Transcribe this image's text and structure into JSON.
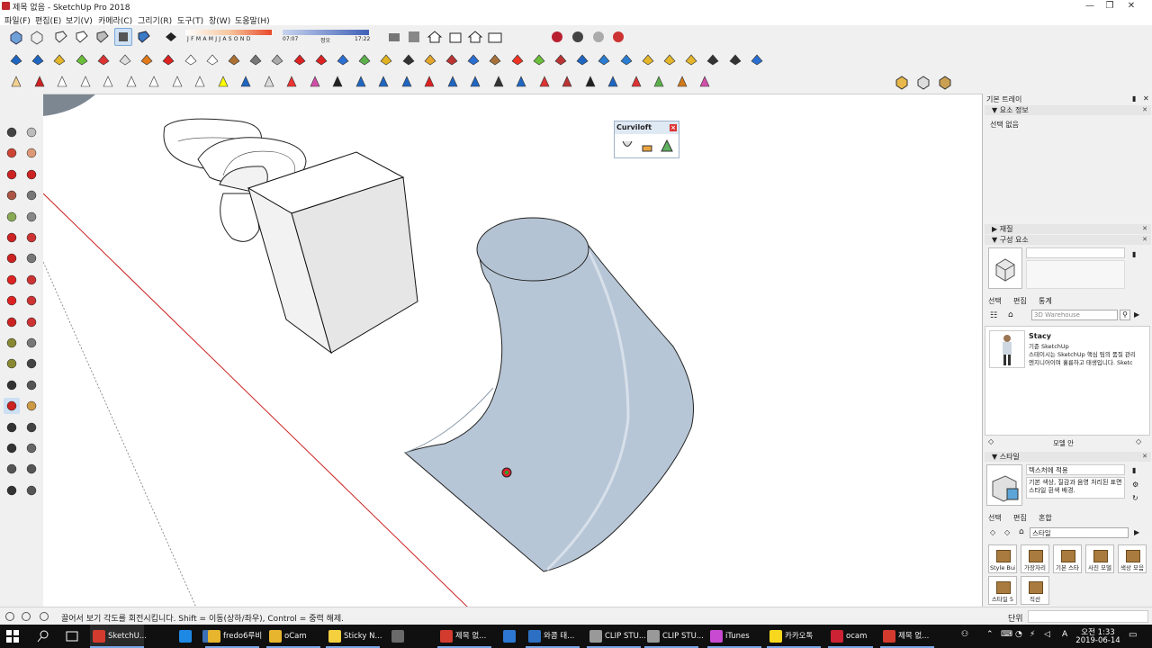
{
  "window": {
    "title": "제목 없음 - SketchUp Pro 2018",
    "minimize": "—",
    "maximize": "❐",
    "close": "✕"
  },
  "menu": [
    "파일(F)",
    "편집(E)",
    "보기(V)",
    "카메라(C)",
    "그리기(R)",
    "도구(T)",
    "창(W)",
    "도움말(H)"
  ],
  "shadow": {
    "months": "J F M A M J J A S O N D",
    "time_start": "07:07",
    "noon": "정오",
    "time_end": "17:22"
  },
  "curviloft": {
    "title": "Curviloft"
  },
  "tray": {
    "title": "기본 트레이",
    "entity_info": {
      "header": "요소 정보",
      "text": "선택 없음"
    },
    "materials": {
      "header": "재질"
    },
    "components": {
      "header": "구성 요소",
      "tabs": [
        "선택",
        "편집",
        "통계"
      ],
      "search_placeholder": "3D Warehouse",
      "item_name": "Stacy",
      "item_line1": "기준 SketchUp",
      "item_line2": "스테이시는 SketchUp 핵심 팀의 품질 관리",
      "item_line3": "엔지니어이며 훌륭하고 태생입니다. Sketc",
      "footer": "모델 안"
    },
    "styles": {
      "header": "스타일",
      "name": "텍스처에 적용",
      "desc": "기본 색상, 질감과 음영 처리된 표면 스타일 흰색 배경.",
      "tabs": [
        "선택",
        "편집",
        "혼합"
      ],
      "dropdown": "스타일",
      "swatches": [
        "Style Buil",
        "가장자리",
        "기본 스타",
        "사진 모델",
        "색상 모음",
        "스타일 5",
        "직선"
      ]
    },
    "unit_label": "단위"
  },
  "status": {
    "message": "끌어서 보기 각도를 회전시킵니다. Shift = 이동(상하/좌우), Control = 중력 해제."
  },
  "taskbar": {
    "items": [
      {
        "label": "SketchU...",
        "color": "#d33b2f"
      },
      {
        "label": "",
        "color": "#1e88e5"
      },
      {
        "label": "",
        "color": "#3d6fb5"
      },
      {
        "label": "fredo6루비",
        "color": "#e7b52e"
      },
      {
        "label": "oCam",
        "color": "#e7b52e"
      },
      {
        "label": "Sticky N...",
        "color": "#f4d03f"
      },
      {
        "label": "",
        "color": "#6a6a6a"
      },
      {
        "label": "제목 없...",
        "color": "#d33b2f"
      },
      {
        "label": "",
        "color": "#2c78d2"
      },
      {
        "label": "와콤 태...",
        "color": "#2d6fc3"
      },
      {
        "label": "CLIP STU...",
        "color": "#999999"
      },
      {
        "label": "CLIP STU...",
        "color": "#999999"
      },
      {
        "label": "iTunes",
        "color": "#c84ad0"
      },
      {
        "label": "카카오톡",
        "color": "#f7d81e"
      },
      {
        "label": "ocam",
        "color": "#cc2233"
      },
      {
        "label": "제목 없...",
        "color": "#d33b2f"
      }
    ],
    "time": "오전 1:33",
    "date": "2019-06-14",
    "lang": "A"
  },
  "colors": {
    "model_blue": "#b5c4d4",
    "axis_red": "#cc2222",
    "tray_header": "#e6e6e6"
  }
}
